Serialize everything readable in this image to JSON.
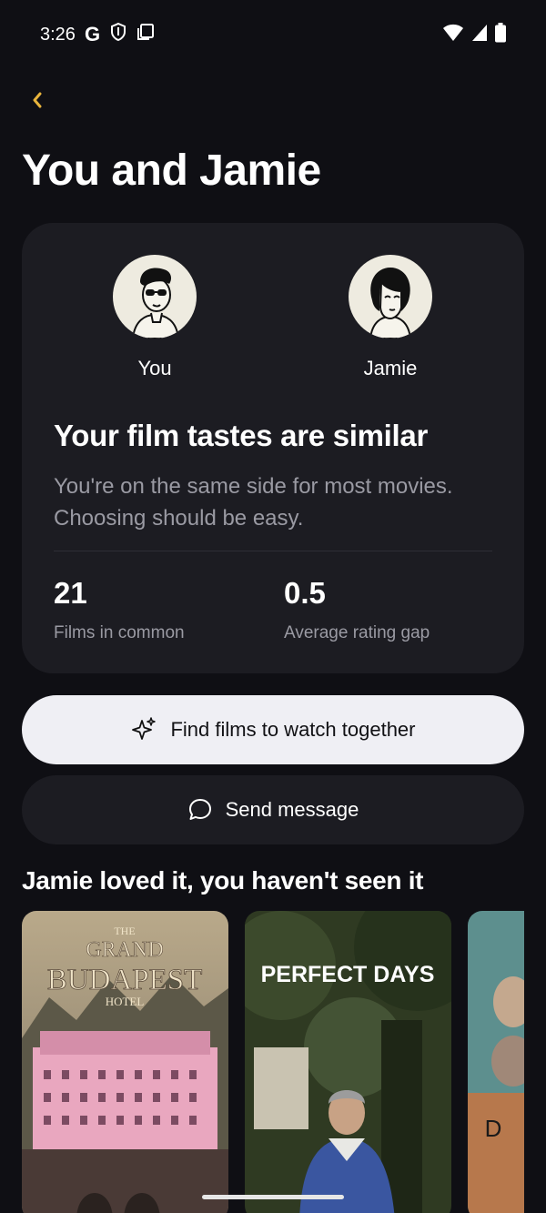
{
  "status_bar": {
    "time": "3:26",
    "google_glyph": "G",
    "icons": [
      "google-icon",
      "shield-icon",
      "screen-icon",
      "wifi-icon",
      "signal-icon",
      "battery-icon"
    ]
  },
  "header": {
    "back_icon": "chevron-left-icon",
    "title": "You and Jamie"
  },
  "comparison": {
    "you_label": "You",
    "jamie_label": "Jamie",
    "heading": "Your film tastes are similar",
    "description": "You're on the same side for most movies. Choosing should be easy.",
    "stats": [
      {
        "value": "21",
        "label": "Films in common"
      },
      {
        "value": "0.5",
        "label": "Average rating gap"
      }
    ]
  },
  "actions": {
    "find_films": "Find films to watch together",
    "find_films_icon": "sparkles-icon",
    "send_message": "Send message",
    "send_message_icon": "chat-bubble-icon"
  },
  "recommendations": {
    "title": "Jamie loved it, you haven't seen it",
    "films": [
      {
        "title_top": "THE",
        "title_main": "GRAND",
        "title_main2": "BUDAPEST",
        "title_sub": "HOTEL"
      },
      {
        "title_main": "PERFECT DAYS"
      },
      {
        "title_main": "D"
      }
    ]
  },
  "colors": {
    "background": "#0f0f14",
    "card": "#1c1c22",
    "accent": "#e8b43c",
    "primary_button": "#efeff4"
  }
}
